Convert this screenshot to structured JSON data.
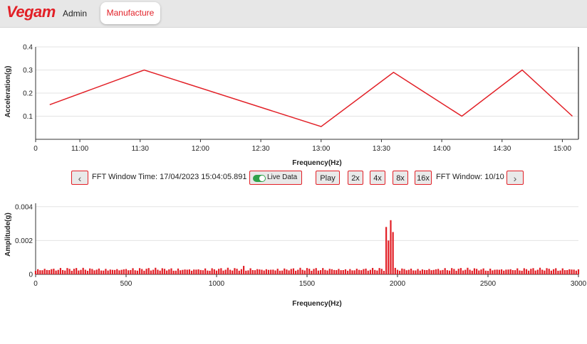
{
  "brand": {
    "logo_text": "Vegam"
  },
  "nav": {
    "admin_label": "Admin",
    "manufacture_label": "Manufacture"
  },
  "colors": {
    "accent": "#e21f26",
    "toggle_on": "#2fa24a"
  },
  "controls": {
    "prev_icon": "chevron-left-icon",
    "next_icon": "chevron-right-icon",
    "fft_time_text": "FFT Window Time: 17/04/2023 15:04:05.891",
    "live_label": "Live Data",
    "live_on": true,
    "play_label": "Play",
    "speed_2x": "2x",
    "speed_4x": "4x",
    "speed_8x": "8x",
    "speed_16x": "16x",
    "fft_window_text": "FFT Window: 10/10"
  },
  "chart_data": [
    {
      "type": "line",
      "xlabel": "Frequency(Hz)",
      "ylabel": "Acceleration(g)",
      "x_tick_labels": [
        "0",
        "11:00",
        "11:30",
        "12:00",
        "12:30",
        "13:00",
        "13:30",
        "14:00",
        "14:30",
        "15:00"
      ],
      "y_tick_labels": [
        "0.1",
        "0.2",
        "0.3",
        "0.4"
      ],
      "ylim": [
        0,
        0.4
      ],
      "grid": true,
      "x": [
        "10:45",
        "11:32",
        "13:00",
        "13:36",
        "14:10",
        "14:40",
        "15:05"
      ],
      "values": [
        0.15,
        0.3,
        0.055,
        0.29,
        0.1,
        0.3,
        0.1
      ],
      "color": "#e21f26"
    },
    {
      "type": "bar",
      "xlabel": "Frequency(Hz)",
      "ylabel": "Amplitude(g)",
      "x_tick_labels": [
        "0",
        "500",
        "1000",
        "1500",
        "2000",
        "2500",
        "3000"
      ],
      "y_tick_labels": [
        "0",
        "0.002",
        "0.004"
      ],
      "xlim": [
        0,
        3000
      ],
      "ylim": [
        0,
        0.0042
      ],
      "grid": true,
      "baseline_amplitude": 0.0003,
      "peaks": [
        {
          "x": 1150,
          "y": 0.0005
        },
        {
          "x": 1935,
          "y": 0.0028
        },
        {
          "x": 1945,
          "y": 0.002
        },
        {
          "x": 1955,
          "y": 0.0038
        },
        {
          "x": 1965,
          "y": 0.0032
        },
        {
          "x": 1975,
          "y": 0.0025
        }
      ],
      "color": "#e21f26"
    }
  ]
}
